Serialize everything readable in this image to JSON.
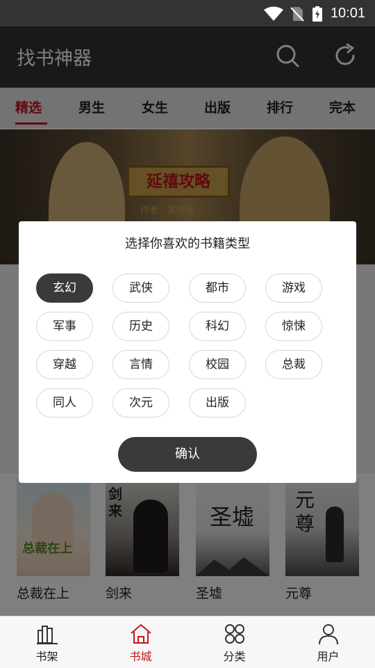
{
  "status": {
    "time": "10:01"
  },
  "appbar": {
    "title": "找书神器"
  },
  "tabs": [
    {
      "label": "精选",
      "active": true
    },
    {
      "label": "男生"
    },
    {
      "label": "女生"
    },
    {
      "label": "出版"
    },
    {
      "label": "排行"
    },
    {
      "label": "完本"
    }
  ],
  "banner": {
    "book_title": "延禧攻略",
    "author": "作者：笑脸猫"
  },
  "books": [
    {
      "name": "总裁在上",
      "cover_text": "总裁在上"
    },
    {
      "name": "剑来",
      "cover_text": "剑来"
    },
    {
      "name": "圣墟",
      "cover_text": "圣墟"
    },
    {
      "name": "元尊",
      "cover_text": "元尊"
    }
  ],
  "dialog": {
    "title": "选择你喜欢的书籍类型",
    "genres": [
      "玄幻",
      "武侠",
      "都市",
      "游戏",
      "军事",
      "历史",
      "科幻",
      "惊悚",
      "穿越",
      "言情",
      "校园",
      "总裁",
      "同人",
      "次元",
      "出版"
    ],
    "selected": "玄幻",
    "confirm_label": "确认"
  },
  "bottom_nav": [
    {
      "label": "书架"
    },
    {
      "label": "书城",
      "active": true
    },
    {
      "label": "分类"
    },
    {
      "label": "用户"
    }
  ],
  "colors": {
    "accent": "#c8141a",
    "appbar": "#333333",
    "chip_selected": "#3a3a3a"
  }
}
